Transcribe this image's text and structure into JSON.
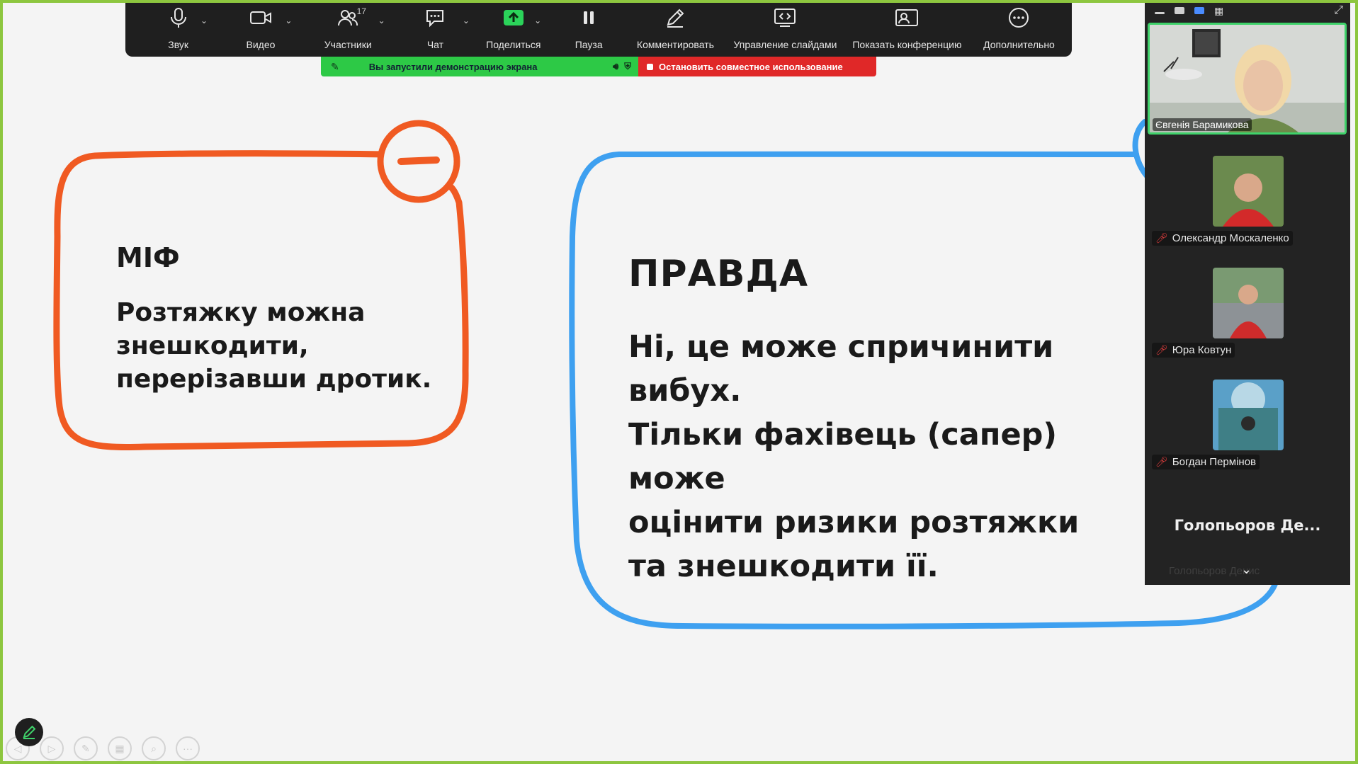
{
  "toolbar": {
    "items": [
      {
        "label": "Звук",
        "icon": "microphone-icon"
      },
      {
        "label": "Видео",
        "icon": "video-camera-icon"
      },
      {
        "label": "Участники",
        "icon": "participants-icon",
        "count": "17"
      },
      {
        "label": "Чат",
        "icon": "chat-icon"
      },
      {
        "label": "Поделиться",
        "icon": "share-screen-icon"
      },
      {
        "label": "Пауза",
        "icon": "pause-icon"
      },
      {
        "label": "Комментировать",
        "icon": "pencil-icon"
      },
      {
        "label": "Управление слайдами",
        "icon": "slides-control-icon"
      },
      {
        "label": "Показать конференцию",
        "icon": "show-meeting-icon"
      },
      {
        "label": "Дополнительно",
        "icon": "more-icon"
      }
    ]
  },
  "share_banner": {
    "message": "Вы запустили демонстрацию экрана",
    "stop_label": "Остановить совместное использование"
  },
  "slide": {
    "myth_title": "МІФ",
    "myth_lines": [
      "Розтяжку можна",
      "знешкодити,",
      "перерізавши дротик."
    ],
    "truth_title": "ПРАВДА",
    "truth_lines": [
      "Ні, це може спричинити вибух.",
      "Тільки фахівець (сапер) може",
      "оцінити ризики розтяжки",
      "та знешкодити її."
    ],
    "colors": {
      "myth": "#f05a22",
      "truth": "#3ea0f0",
      "share_border": "#8dc63f"
    }
  },
  "video_panel": {
    "active_speaker": "Євгенія Барамикова",
    "participants": [
      {
        "name": "Олександр Москаленко",
        "muted": true
      },
      {
        "name": "Юра Ковтун",
        "muted": true
      },
      {
        "name": "Богдан Пермінов",
        "muted": true
      }
    ],
    "big_name": "Голопьоров Де...",
    "faded_name": "Голопьоров Денис"
  }
}
